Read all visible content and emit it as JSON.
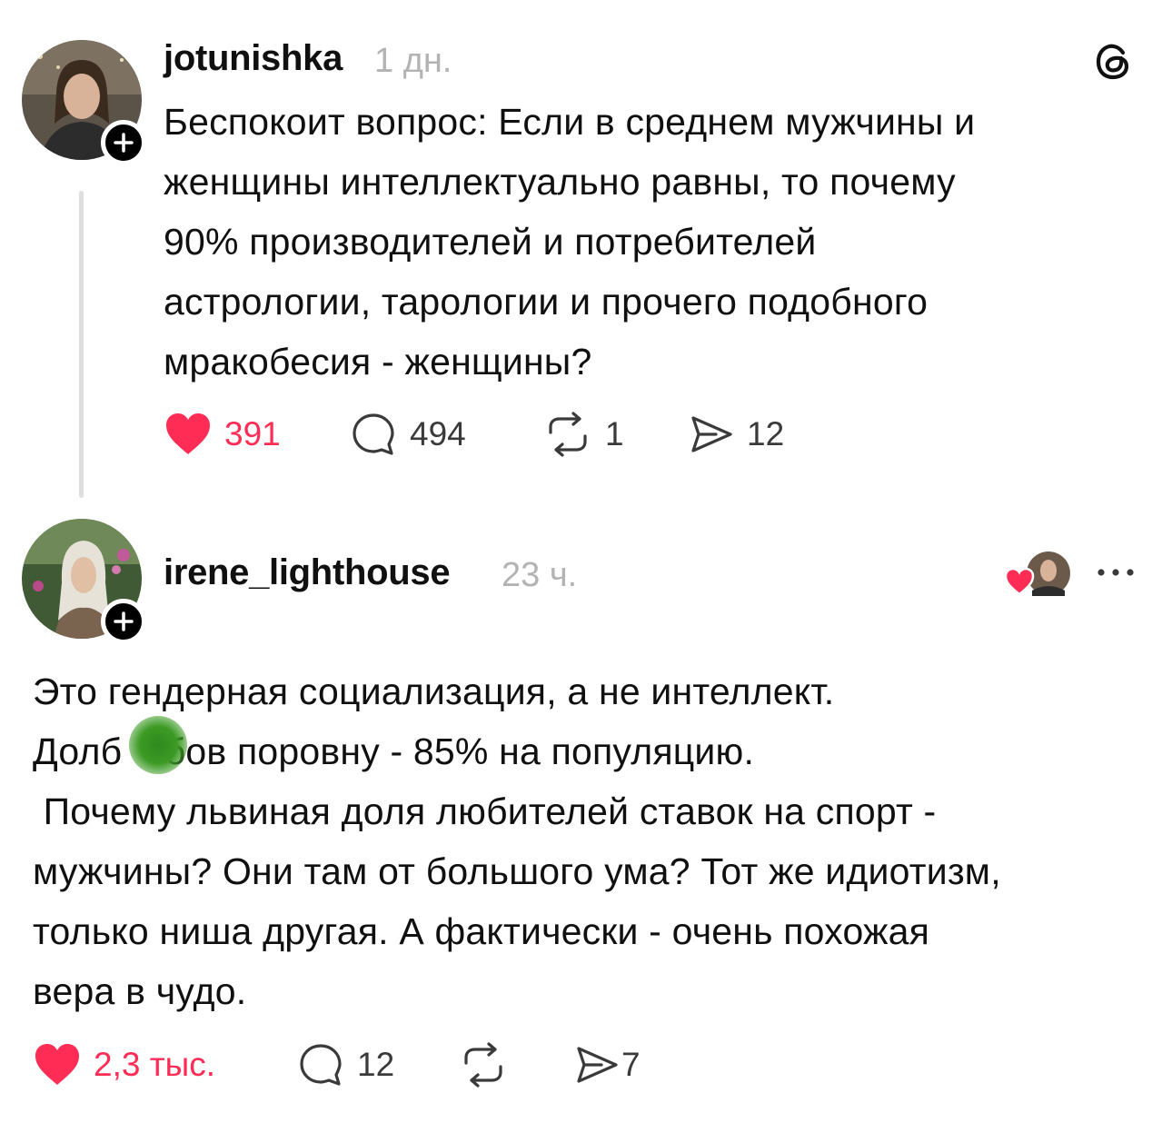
{
  "colors": {
    "like": "#ff2d55",
    "text": "#101010",
    "muted": "#b3b3b3",
    "icon": "#3a3a3a",
    "censor": "#3c9a24"
  },
  "post": {
    "username": "jotunishka",
    "time": "1 дн.",
    "text_lines": [
      "Беспокоит вопрос: Если в среднем мужчины и",
      "женщины интеллектуально равны, то почему",
      "90% производителей и потребителей",
      "астрологии, тарологии и прочего подобного",
      "мракобесия - женщины?"
    ],
    "likes": "391",
    "comments": "494",
    "reposts": "1",
    "shares": "12",
    "liked": true,
    "menu_icon": "threads-logo-icon"
  },
  "reply": {
    "username": "irene_lighthouse",
    "time": "23 ч.",
    "text_lines": [
      "Это гендерная социализация, а не интеллект.",
      "Долб    бов поровну - 85% на популяцию.",
      " Почему львиная доля любителей ставок на спорт -",
      "мужчины? Они там от большого ума? Тот же идиотизм,",
      "только ниша другая. А фактически - очень похожая",
      "вера в чудо."
    ],
    "likes": "2,3 тыс.",
    "comments": "12",
    "reposts": "",
    "shares": "7",
    "liked": true,
    "liked_by_author_icon": "author-liked-heart-icon",
    "more_icon": "more-dots-icon"
  }
}
